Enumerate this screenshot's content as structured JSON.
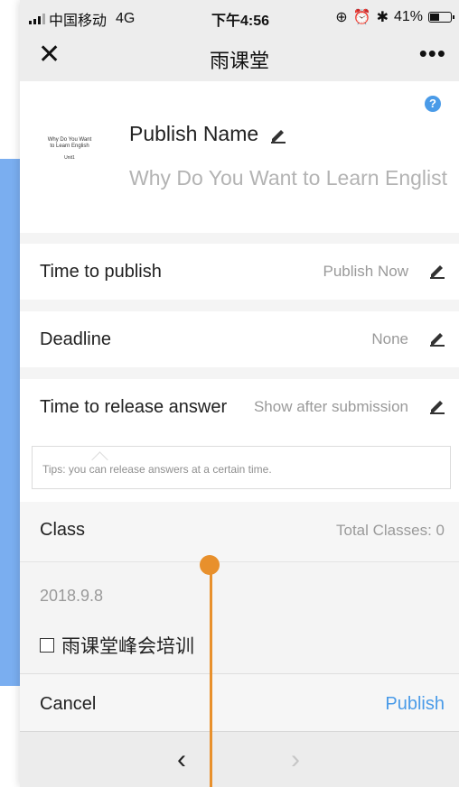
{
  "status_bar": {
    "carrier": "中国移动",
    "network": "4G",
    "time": "下午4:56",
    "battery": "41%"
  },
  "nav": {
    "close_icon": "close-icon",
    "title": "雨课堂",
    "more": "•••"
  },
  "header": {
    "help": "?",
    "thumbnail": {
      "line1": "Why Do You Want",
      "line2": "to Learn English",
      "line3": "Unit1"
    },
    "publish_name_label": "Publish Name",
    "publish_name_value": "Why Do You Want to Learn Englist"
  },
  "rows": {
    "time_to_publish": {
      "label": "Time to publish",
      "value": "Publish Now"
    },
    "deadline": {
      "label": "Deadline",
      "value": "None"
    },
    "release_answer": {
      "label": "Time to release answer",
      "value": "Show after submission"
    }
  },
  "tips": "Tips: you can release answers at a certain time.",
  "class": {
    "label": "Class",
    "value": "Total Classes: 0"
  },
  "date": "2018.9.8",
  "class_item": "雨课堂峰会培训",
  "actions": {
    "cancel": "Cancel",
    "publish": "Publish"
  },
  "toolbar": {
    "back": "‹",
    "forward": "›"
  },
  "colors": {
    "accent": "#4a9be8",
    "marker": "#e8902c",
    "side_strip": "#7aaef0"
  }
}
